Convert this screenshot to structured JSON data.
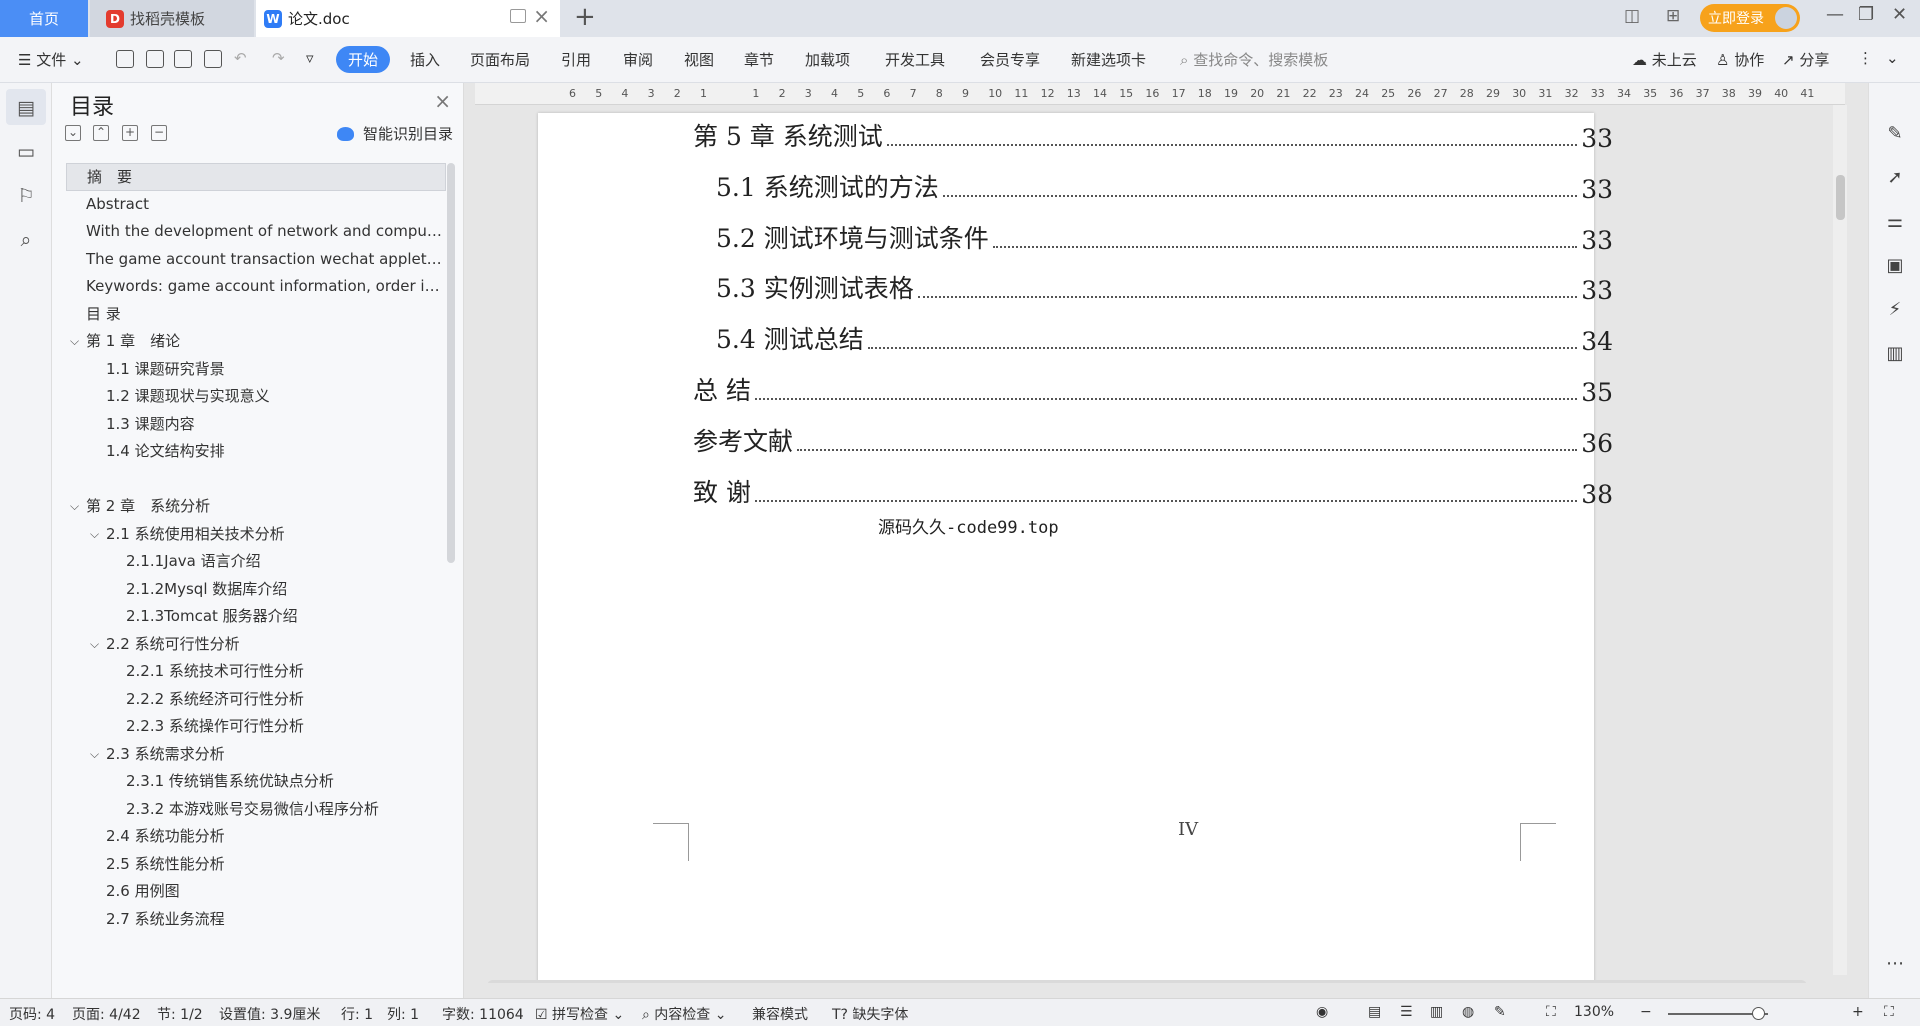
{
  "tabs": {
    "home": "首页",
    "templates": "找稻壳模板",
    "document": "论文.doc"
  },
  "login": "立即登录",
  "ribbon": {
    "file": "文件",
    "start": "开始",
    "insert": "插入",
    "layout": "页面布局",
    "reference": "引用",
    "review": "审阅",
    "view": "视图",
    "chapter": "章节",
    "addons": "加载项",
    "devtools": "开发工具",
    "member": "会员专享",
    "newtab": "新建选项卡",
    "search_placeholder": "查找命令、搜索模板",
    "cloud": "未上云",
    "collab": "协作",
    "share": "分享"
  },
  "toc_panel": {
    "title": "目录",
    "smart": "智能识别目录",
    "items": [
      {
        "label": "摘　要",
        "level": 0,
        "caret": false,
        "selected": true
      },
      {
        "label": "Abstract",
        "level": 0,
        "caret": false
      },
      {
        "label": "With the development of network and computer technology…",
        "level": 0,
        "caret": false
      },
      {
        "label": "The game account transaction wechat applet …",
        "level": 0,
        "caret": false
      },
      {
        "label": "Keywords: game account information, order inform…",
        "level": 0,
        "caret": false
      },
      {
        "label": "目 录",
        "level": 0,
        "caret": false
      },
      {
        "label": "第 1 章　绪论",
        "level": 0,
        "caret": true
      },
      {
        "label": "1.1 课题研究背景",
        "level": 1,
        "caret": false
      },
      {
        "label": "1.2 课题现状与实现意义",
        "level": 1,
        "caret": false
      },
      {
        "label": "1.3 课题内容",
        "level": 1,
        "caret": false
      },
      {
        "label": "1.4 论文结构安排",
        "level": 1,
        "caret": false
      },
      {
        "label": "",
        "level": 1,
        "caret": false
      },
      {
        "label": "第 2 章　系统分析",
        "level": 0,
        "caret": true
      },
      {
        "label": "2.1 系统使用相关技术分析",
        "level": 1,
        "caret": true
      },
      {
        "label": "2.1.1Java 语言介绍",
        "level": 2,
        "caret": false
      },
      {
        "label": "2.1.2Mysql 数据库介绍",
        "level": 2,
        "caret": false
      },
      {
        "label": "2.1.3Tomcat 服务器介绍",
        "level": 2,
        "caret": false
      },
      {
        "label": "2.2 系统可行性分析",
        "level": 1,
        "caret": true
      },
      {
        "label": "2.2.1 系统技术可行性分析",
        "level": 2,
        "caret": false
      },
      {
        "label": "2.2.2 系统经济可行性分析",
        "level": 2,
        "caret": false
      },
      {
        "label": "2.2.3 系统操作可行性分析",
        "level": 2,
        "caret": false
      },
      {
        "label": "2.3 系统需求分析",
        "level": 1,
        "caret": true
      },
      {
        "label": "2.3.1 传统销售系统优缺点分析",
        "level": 2,
        "caret": false
      },
      {
        "label": "2.3.2 本游戏账号交易微信小程序分析",
        "level": 2,
        "caret": false
      },
      {
        "label": "2.4 系统功能分析",
        "level": 1,
        "caret": false
      },
      {
        "label": "2.5 系统性能分析",
        "level": 1,
        "caret": false
      },
      {
        "label": "2.6 用例图",
        "level": 1,
        "caret": false
      },
      {
        "label": "2.7 系统业务流程",
        "level": 1,
        "caret": false
      }
    ]
  },
  "ruler": [
    "6",
    "5",
    "4",
    "3",
    "2",
    "1",
    "",
    "1",
    "2",
    "3",
    "4",
    "5",
    "6",
    "7",
    "8",
    "9",
    "10",
    "11",
    "12",
    "13",
    "14",
    "15",
    "16",
    "17",
    "18",
    "19",
    "20",
    "21",
    "22",
    "23",
    "24",
    "25",
    "26",
    "27",
    "28",
    "29",
    "30",
    "31",
    "32",
    "33",
    "34",
    "35",
    "36",
    "37",
    "38",
    "39",
    "40",
    "41"
  ],
  "document": {
    "toc_lines": [
      {
        "text": "第 5 章  系统测试",
        "page": "33",
        "sub": false
      },
      {
        "text": "5.1 系统测试的方法",
        "page": "33",
        "sub": true
      },
      {
        "text": "5.2 测试环境与测试条件",
        "page": "33",
        "sub": true
      },
      {
        "text": "5.3 实例测试表格",
        "page": "33",
        "sub": true
      },
      {
        "text": "5.4 测试总结",
        "page": "34",
        "sub": true
      },
      {
        "text": "总   结",
        "page": "35",
        "sub": false
      },
      {
        "text": "参考文献",
        "page": "36",
        "sub": false
      },
      {
        "text": "致    谢",
        "page": "38",
        "sub": false
      }
    ],
    "watermark": "源码久久-code99.top",
    "page_number": "IV"
  },
  "status": {
    "page_no": "页码: 4",
    "pages": "页面: 4/42",
    "section": "节: 1/2",
    "setting": "设置值: 3.9厘米",
    "row": "行: 1",
    "col": "列: 1",
    "words": "字数: 11064",
    "spell": "拼写检查",
    "content_check": "内容检查",
    "compat": "兼容模式",
    "missing_font": "缺失字体",
    "zoom": "130%"
  },
  "icons": {
    "accent": "#3e87f5",
    "login_color": "#f7a21b"
  }
}
